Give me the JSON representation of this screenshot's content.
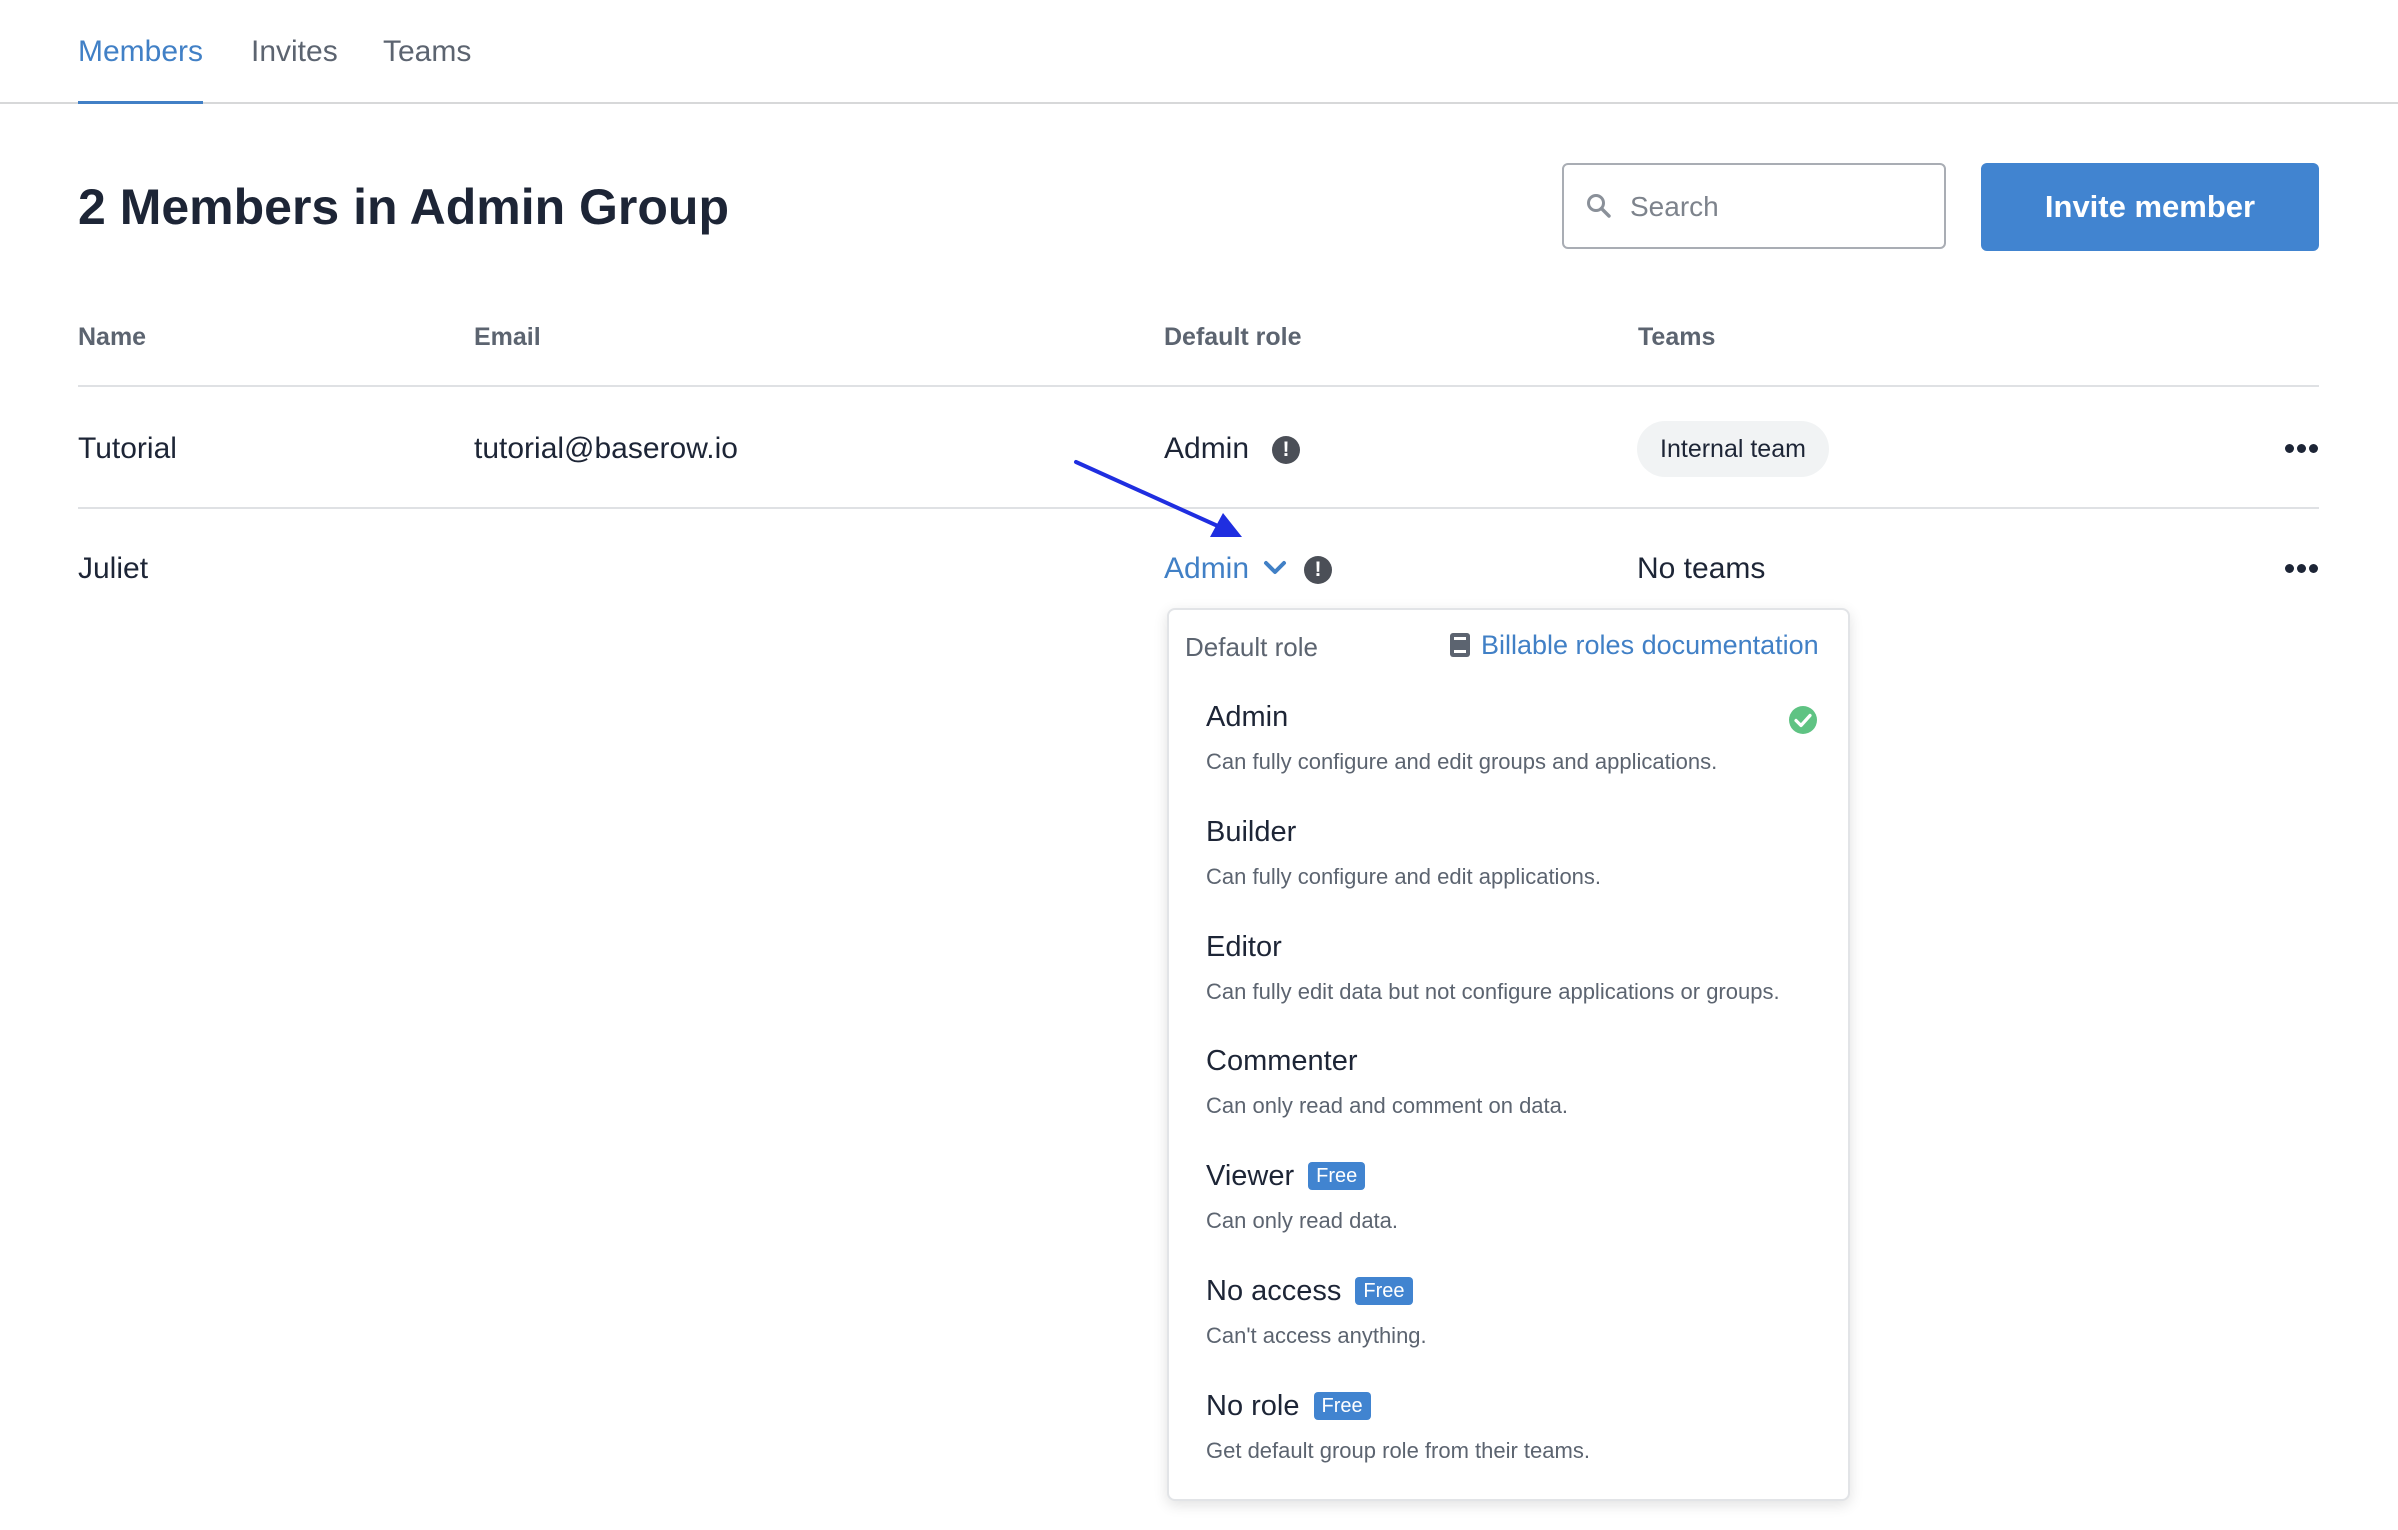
{
  "tabs": [
    {
      "label": "Members",
      "active": true
    },
    {
      "label": "Invites",
      "active": false
    },
    {
      "label": "Teams",
      "active": false
    }
  ],
  "page": {
    "title": "2 Members in Admin Group"
  },
  "search": {
    "placeholder": "Search",
    "value": ""
  },
  "invite_button": {
    "label": "Invite member"
  },
  "table": {
    "headers": [
      "Name",
      "Email",
      "Default role",
      "Teams"
    ],
    "rows": [
      {
        "name": "Tutorial",
        "email": "tutorial@baserow.io",
        "role": "Admin",
        "teams": "Internal team"
      },
      {
        "name": "Juliet",
        "email": "",
        "role": "Admin",
        "teams": "No teams"
      }
    ]
  },
  "dropdown": {
    "title": "Default role",
    "doc_link": "Billable roles documentation",
    "roles": [
      {
        "name": "Admin",
        "desc": "Can fully configure and edit groups and applications.",
        "badge": "",
        "selected": true
      },
      {
        "name": "Builder",
        "desc": "Can fully configure and edit applications.",
        "badge": "",
        "selected": false
      },
      {
        "name": "Editor",
        "desc": "Can fully edit data but not configure applications or groups.",
        "badge": "",
        "selected": false
      },
      {
        "name": "Commenter",
        "desc": "Can only read and comment on data.",
        "badge": "",
        "selected": false
      },
      {
        "name": "Viewer",
        "desc": "Can only read data.",
        "badge": "Free",
        "selected": false
      },
      {
        "name": "No access",
        "desc": "Can't access anything.",
        "badge": "Free",
        "selected": false
      },
      {
        "name": "No role",
        "desc": "Get default group role from their teams.",
        "badge": "Free",
        "selected": false
      }
    ]
  },
  "colors": {
    "accent": "#4180c6",
    "button": "#4184d0",
    "check": "#5fc383",
    "annotation_arrow": "#1f2ee0"
  },
  "icons": {
    "info": "exclamation-circle-icon",
    "more": "ellipsis-icon",
    "chevron": "chevron-down-icon",
    "search": "search-icon",
    "doc": "book-icon",
    "check": "check-circle-icon"
  }
}
